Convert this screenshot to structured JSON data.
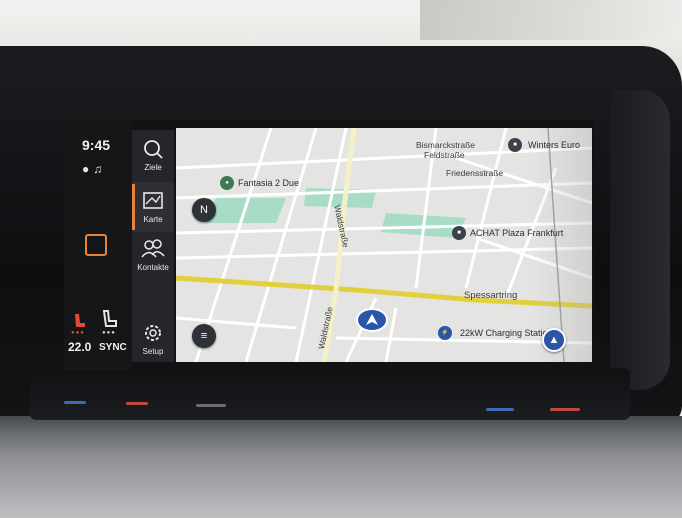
{
  "status": {
    "time": "9:45",
    "icons": [
      "globe-icon",
      "voice-icon"
    ],
    "temperature": "22.0",
    "sync_label": "SYNC"
  },
  "nav_menu": [
    {
      "label": "Ziele",
      "icon": "search-icon",
      "active": false
    },
    {
      "label": "Karte",
      "icon": "map-icon",
      "active": true
    },
    {
      "label": "Kontakte",
      "icon": "contacts-icon",
      "active": false
    },
    {
      "label": "Setup",
      "icon": "gear-icon",
      "active": false
    }
  ],
  "map": {
    "street_labels": [
      "Bismarckstraße",
      "Feldstraße",
      "Friedensstraße",
      "Waldstraße",
      "Spessartring",
      "Waldstraße"
    ],
    "pois": [
      {
        "label": "Fantasia 2 Due",
        "icon": "restaurant-icon"
      },
      {
        "label": "ACHAT Plaza Frankfurt",
        "icon": "hotel-icon"
      },
      {
        "label": "Winters Euro",
        "icon": "hotel-icon"
      },
      {
        "label": "22kW Charging Station",
        "icon": "charging-icon"
      }
    ],
    "buttons": {
      "compass": "compass-icon",
      "menu": "menu-icon",
      "current_position": "navigation-arrow-icon"
    }
  },
  "colors": {
    "accent": "#e8843a",
    "main_road": "#e2cf3c",
    "vehicle": "#2a55a8",
    "map_background": "#e4e4e2"
  }
}
